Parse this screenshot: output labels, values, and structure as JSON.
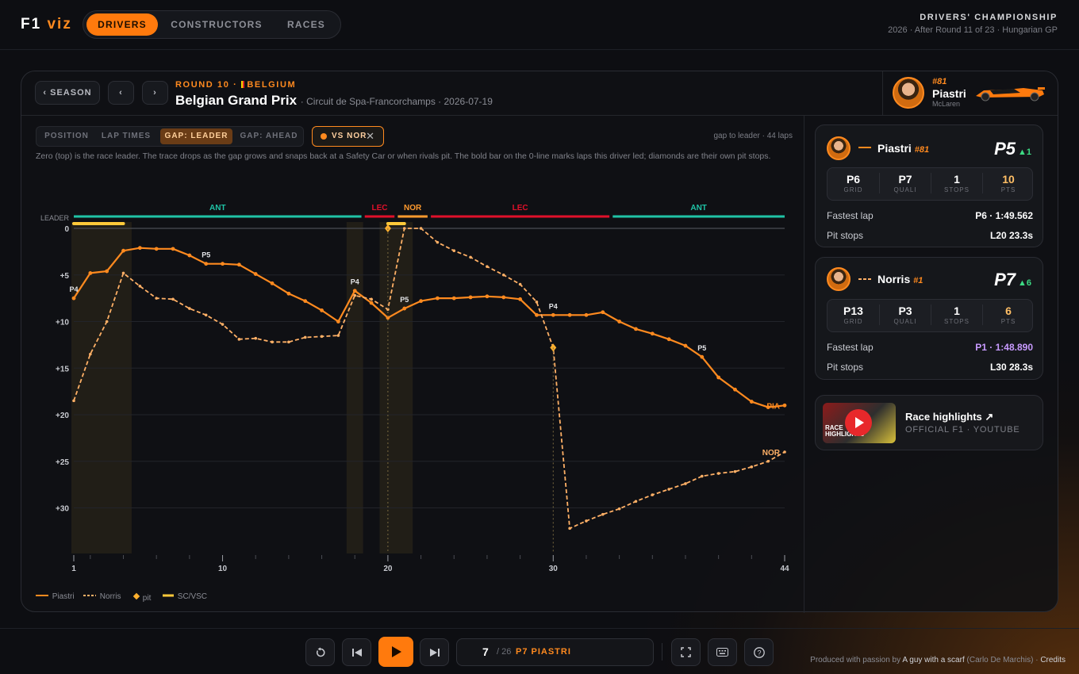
{
  "brand": {
    "name_a": "F1",
    "name_b": "viz"
  },
  "nav": {
    "tabs": [
      "DRIVERS",
      "CONSTRUCTORS",
      "RACES"
    ],
    "active": "DRIVERS"
  },
  "championship": {
    "title": "DRIVERS' CHAMPIONSHIP",
    "subtitle": "2026 · After Round 11 of 23 · Hungarian GP"
  },
  "race_header": {
    "season_btn": "‹ SEASON",
    "prev": "‹",
    "next": "›",
    "round_label": "ROUND 10 ·",
    "country": "BELGIUM",
    "gp_name": "Belgian Grand Prix",
    "circuit": "· Circuit de Spa-Francorchamps · 2026-07-19"
  },
  "driver_badge": {
    "number": "#81",
    "name": "Piastri",
    "team": "McLaren"
  },
  "view_tabs": [
    "POSITION",
    "LAP TIMES",
    "GAP: LEADER",
    "GAP: AHEAD"
  ],
  "active_view": "GAP: LEADER",
  "compare_chip": {
    "label": "VS NOR",
    "close": "✕"
  },
  "gap_note": "gap to leader · 44 laps",
  "description": "Zero (top) is the race leader. The trace drops as the gap grows and snaps back at a Safety Car or when rivals pit. The bold bar on the 0-line marks laps this driver led; diamonds are their own pit stops.",
  "legend": {
    "piastri": "Piastri",
    "norris": "Norris",
    "pit": "pit",
    "sc": "SC/VSC"
  },
  "colors": {
    "piastri": "#ff8a1f",
    "norris": "#ffb066",
    "ant": "#1fc3a6",
    "lec": "#e0102a",
    "nor": "#ff9a2e",
    "sc": "#ffc93a",
    "accent": "#ff7a0d",
    "gain": "#3ddc84"
  },
  "chart_data": {
    "type": "line",
    "xlabel": "",
    "ylabel": "",
    "x_ticks": [
      1,
      10,
      20,
      30,
      44
    ],
    "xlim": [
      1,
      44
    ],
    "y_ticks": [
      0,
      5,
      10,
      15,
      20,
      25,
      30
    ],
    "y_tick_labels": [
      "0",
      "+5",
      "+10",
      "+15",
      "+20",
      "+25",
      "+30"
    ],
    "y_top_label": "LEADER",
    "ylim": [
      0,
      34.5
    ],
    "y_inverted": true,
    "series": [
      {
        "name": "Piastri",
        "style": "solid",
        "x": [
          1,
          2,
          3,
          4,
          5,
          6,
          7,
          8,
          9,
          10,
          11,
          12,
          13,
          14,
          15,
          16,
          17,
          18,
          19,
          20,
          21,
          22,
          23,
          24,
          25,
          26,
          27,
          28,
          29,
          30,
          31,
          32,
          33,
          34,
          35,
          36,
          37,
          38,
          39,
          40,
          41,
          42,
          43,
          44
        ],
        "y": [
          7.5,
          4.8,
          4.6,
          2.4,
          2.1,
          2.2,
          2.2,
          2.9,
          3.8,
          3.8,
          3.9,
          4.9,
          5.9,
          7.0,
          7.8,
          8.8,
          10.0,
          6.7,
          8.0,
          9.6,
          8.6,
          7.8,
          7.5,
          7.5,
          7.4,
          7.3,
          7.4,
          7.6,
          9.3,
          9.3,
          9.3,
          9.3,
          9.0,
          10.0,
          10.8,
          11.3,
          11.9,
          12.6,
          13.8,
          16.0,
          17.3,
          18.6,
          19.2,
          19.0
        ],
        "labels": [
          {
            "x": 1,
            "text": "P4"
          },
          {
            "x": 9,
            "text": "P5"
          },
          {
            "x": 18,
            "text": "P4"
          },
          {
            "x": 21,
            "text": "P5"
          },
          {
            "x": 30,
            "text": "P4"
          },
          {
            "x": 39,
            "text": "P5"
          }
        ],
        "end_label": "PIA"
      },
      {
        "name": "Norris",
        "style": "dashed",
        "x": [
          1,
          2,
          3,
          4,
          5,
          6,
          7,
          8,
          9,
          10,
          11,
          12,
          13,
          14,
          15,
          16,
          17,
          18,
          19,
          20,
          21,
          22,
          23,
          24,
          25,
          26,
          27,
          28,
          29,
          30,
          31,
          32,
          33,
          34,
          35,
          36,
          37,
          38,
          39,
          40,
          41,
          42,
          43,
          44
        ],
        "y": [
          18.5,
          13.5,
          10.0,
          4.8,
          6.2,
          7.5,
          7.6,
          8.6,
          9.3,
          10.3,
          11.9,
          11.8,
          12.2,
          12.2,
          11.7,
          11.6,
          11.5,
          7.2,
          7.6,
          8.7,
          0,
          0,
          1.5,
          2.4,
          3.1,
          4.1,
          5.0,
          6.0,
          7.9,
          12.8,
          32.2,
          31.4,
          30.7,
          30.1,
          29.3,
          28.6,
          28.0,
          27.4,
          26.6,
          26.3,
          26.1,
          25.6,
          25.0,
          24.0
        ],
        "end_label": "NOR"
      }
    ],
    "pits": [
      {
        "driver": "Norris",
        "x": 20,
        "y": 0
      },
      {
        "driver": "Norris",
        "x": 30,
        "y": 12.8
      }
    ],
    "led_laps": [
      {
        "from": 1,
        "to": 4
      },
      {
        "from": 20,
        "to": 21
      }
    ],
    "sc_periods": [
      {
        "from": 1,
        "to": 4
      },
      {
        "from": 18,
        "to": 18
      },
      {
        "from": 20,
        "to": 21
      }
    ],
    "leaders": [
      {
        "driver": "ANT",
        "from": 1,
        "to": 18
      },
      {
        "driver": "LEC",
        "from": 19,
        "to": 20
      },
      {
        "driver": "NOR",
        "from": 21,
        "to": 22
      },
      {
        "driver": "LEC",
        "from": 23,
        "to": 33
      },
      {
        "driver": "ANT",
        "from": 34,
        "to": 44
      }
    ],
    "grid": true,
    "legend_position": "bottom-left"
  },
  "drivers": [
    {
      "name": "Piastri",
      "num": "#81",
      "pos": "P5",
      "delta": "▲1",
      "stats": [
        {
          "v": "P6",
          "l": "GRID"
        },
        {
          "v": "P7",
          "l": "QUALI"
        },
        {
          "v": "1",
          "l": "STOPS"
        },
        {
          "v": "10",
          "l": "PTS"
        }
      ],
      "fastest_label": "Fastest lap",
      "fastest": "P6 · 1:49.562",
      "pits_label": "Pit stops",
      "pits": "L20 23.3s"
    },
    {
      "name": "Norris",
      "num": "#1",
      "pos": "P7",
      "delta": "▲6",
      "stats": [
        {
          "v": "P13",
          "l": "GRID"
        },
        {
          "v": "P3",
          "l": "QUALI"
        },
        {
          "v": "1",
          "l": "STOPS"
        },
        {
          "v": "6",
          "l": "PTS"
        }
      ],
      "fastest_label": "Fastest lap",
      "fastest": "P1 · 1:48.890",
      "pits_label": "Pit stops",
      "pits": "L30 28.3s"
    }
  ],
  "highlights": {
    "title": "Race highlights ↗",
    "sub": "OFFICIAL F1 · YOUTUBE",
    "thumb_text": "RACE HIGHLIGHTS"
  },
  "playback": {
    "lap_current": "7",
    "lap_total": "/ 26",
    "lap_driver": "P7 PIASTRI"
  },
  "credit": {
    "prefix": "Produced with passion by",
    "author": "A guy with a scarf",
    "real": "(Carlo De Marchis) ·",
    "link": "Credits"
  }
}
